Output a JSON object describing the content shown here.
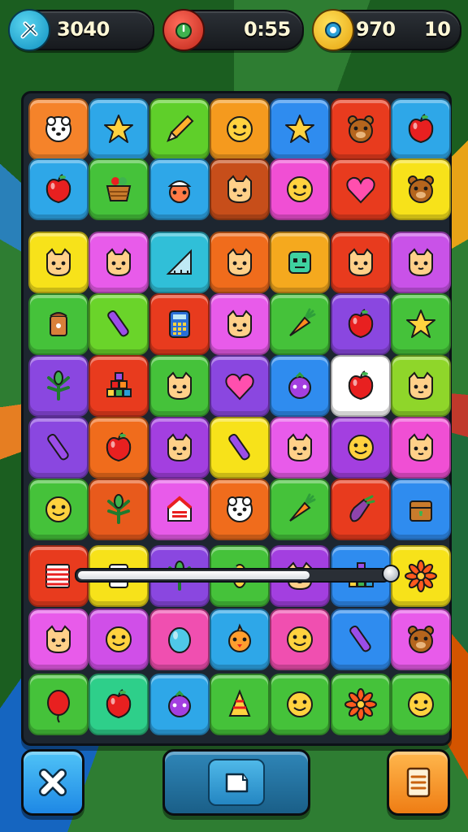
{
  "hud": {
    "score": "3040",
    "timer": "0:55",
    "coins": "970",
    "level": "10",
    "icons": {
      "score": "tools-icon",
      "timer": "timer-icon",
      "coins": "coin-icon"
    }
  },
  "board": {
    "columns": 7,
    "rows": 10,
    "progress_fraction": 0.75,
    "tiles": [
      {
        "color": "#f5832a",
        "icon": "sheep"
      },
      {
        "color": "#2ea7e8",
        "icon": "star"
      },
      {
        "color": "#5fcf2a",
        "icon": "pencil"
      },
      {
        "color": "#f59a1e",
        "icon": "face"
      },
      {
        "color": "#2f8cef",
        "icon": "star"
      },
      {
        "color": "#e83b1e",
        "icon": "bear"
      },
      {
        "color": "#2ea7e8",
        "icon": "apple"
      },
      {
        "color": "#2ea7e8",
        "icon": "apple"
      },
      {
        "color": "#45c23a",
        "icon": "basket"
      },
      {
        "color": "#2ea7e8",
        "icon": "hatface"
      },
      {
        "color": "#c74e1a",
        "icon": "cat"
      },
      {
        "color": "#f04fd4",
        "icon": "face"
      },
      {
        "color": "#e83b1e",
        "icon": "heart"
      },
      {
        "color": "#f7e21a",
        "icon": "bear"
      },
      {
        "color": "#f7e21a",
        "icon": "cat"
      },
      {
        "color": "#e85bea",
        "icon": "cat"
      },
      {
        "color": "#30bfd8",
        "icon": "ruler"
      },
      {
        "color": "#f06c1c",
        "icon": "cat"
      },
      {
        "color": "#f5a91e",
        "icon": "robot"
      },
      {
        "color": "#e83b1e",
        "icon": "cat"
      },
      {
        "color": "#c952e8",
        "icon": "cat"
      },
      {
        "color": "#45c23a",
        "icon": "can"
      },
      {
        "color": "#6ad42a",
        "icon": "crayon"
      },
      {
        "color": "#e83b1e",
        "icon": "calculator"
      },
      {
        "color": "#e85bea",
        "icon": "cat"
      },
      {
        "color": "#45c23a",
        "icon": "carrot"
      },
      {
        "color": "#8a47e0",
        "icon": "apple"
      },
      {
        "color": "#45c23a",
        "icon": "star"
      },
      {
        "color": "#8a47e0",
        "icon": "leaf"
      },
      {
        "color": "#e83b1e",
        "icon": "blocks"
      },
      {
        "color": "#45c23a",
        "icon": "cat"
      },
      {
        "color": "#8a47e0",
        "icon": "heart"
      },
      {
        "color": "#2f8cef",
        "icon": "berry"
      },
      {
        "color": "#ffffff",
        "icon": "apple"
      },
      {
        "color": "#8fd62a",
        "icon": "cat"
      },
      {
        "color": "#8a47e0",
        "icon": "crayon"
      },
      {
        "color": "#f06c1c",
        "icon": "apple"
      },
      {
        "color": "#a33fe0",
        "icon": "cat"
      },
      {
        "color": "#f7e21a",
        "icon": "crayon"
      },
      {
        "color": "#e85bea",
        "icon": "cat"
      },
      {
        "color": "#a33fe0",
        "icon": "face"
      },
      {
        "color": "#f04fd4",
        "icon": "cat"
      },
      {
        "color": "#45c23a",
        "icon": "face"
      },
      {
        "color": "#e85a1c",
        "icon": "leaf"
      },
      {
        "color": "#e85bea",
        "icon": "house"
      },
      {
        "color": "#f06c1c",
        "icon": "sheep"
      },
      {
        "color": "#45c23a",
        "icon": "carrot"
      },
      {
        "color": "#e83b1e",
        "icon": "eggplant"
      },
      {
        "color": "#2f8cef",
        "icon": "box"
      },
      {
        "color": "#e83b1e",
        "icon": "book"
      },
      {
        "color": "#f7e21a",
        "icon": "cup"
      },
      {
        "color": "#8a47e0",
        "icon": "leaf"
      },
      {
        "color": "#45c23a",
        "icon": "corn"
      },
      {
        "color": "#a33fe0",
        "icon": "cat"
      },
      {
        "color": "#2f8cef",
        "icon": "blocks"
      },
      {
        "color": "#f7e21a",
        "icon": "flower"
      },
      {
        "color": "#e85bea",
        "icon": "cat"
      },
      {
        "color": "#d04fe8",
        "icon": "face"
      },
      {
        "color": "#f04fb0",
        "icon": "egg"
      },
      {
        "color": "#2ea7e8",
        "icon": "bird"
      },
      {
        "color": "#f04fb0",
        "icon": "face"
      },
      {
        "color": "#2f8cef",
        "icon": "crayon"
      },
      {
        "color": "#e85bea",
        "icon": "bear"
      },
      {
        "color": "#45c23a",
        "icon": "balloon"
      },
      {
        "color": "#2ecf8a",
        "icon": "apple"
      },
      {
        "color": "#2ea7e8",
        "icon": "berry"
      },
      {
        "color": "#45c23a",
        "icon": "hat"
      },
      {
        "color": "#45c23a",
        "icon": "face"
      },
      {
        "color": "#45c23a",
        "icon": "flower"
      },
      {
        "color": "#45c23a",
        "icon": "face"
      }
    ]
  },
  "bottom": {
    "left_icon": "close-icon",
    "middle_icon": "card-icon",
    "right_icon": "menu-icon"
  }
}
